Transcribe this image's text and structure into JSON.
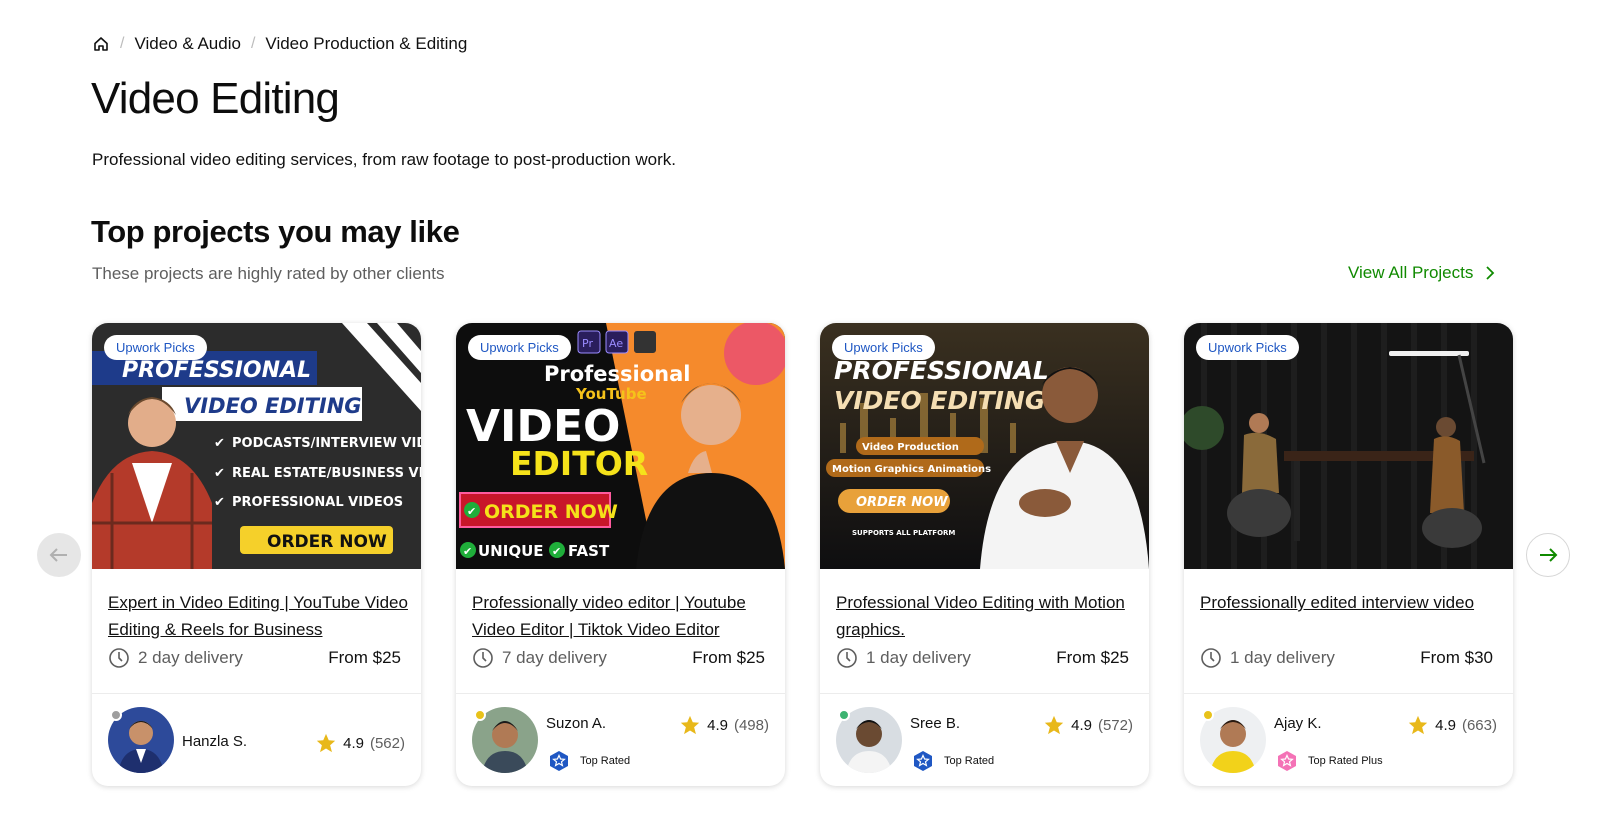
{
  "breadcrumb": {
    "home_icon": "home-icon",
    "items": [
      "Video & Audio",
      "Video Production & Editing"
    ]
  },
  "page": {
    "title": "Video Editing",
    "description": "Professional video editing services, from raw footage to post-production work."
  },
  "section": {
    "title": "Top projects you may like",
    "subtitle": "These projects are highly rated by other clients",
    "view_all": "View All Projects"
  },
  "colors": {
    "accent_green": "#108a00",
    "badge_blue": "#1f57c3",
    "top_rated_blue": "#1f57c3",
    "top_rated_plus_pink": "#f472b6",
    "star": "#e8b81a"
  },
  "cards": [
    {
      "badge": "Upwork Picks",
      "title": "Expert in Video Editing | YouTube Video Editing & Reels for Business",
      "delivery": "2 day delivery",
      "price": "From $25",
      "seller": "Hanzla S.",
      "status_color": "#9e9e9e",
      "level": "",
      "rating": "4.9",
      "reviews": "(562)",
      "thumb": {
        "line1": "PROFESSIONAL",
        "line2": "VIDEO EDITING",
        "bullets": [
          "PODCASTS/INTERVIEW VIDEO",
          "REAL ESTATE/BUSINESS VIDEO",
          "PROFESSIONAL VIDEOS"
        ],
        "cta": "ORDER NOW"
      }
    },
    {
      "badge": "Upwork Picks",
      "title": "Professionally video editor | Youtube Video Editor | Tiktok Video Editor",
      "delivery": "7 day delivery",
      "price": "From $25",
      "seller": "Suzon A.",
      "status_color": "#e8c21a",
      "level": "Top Rated",
      "level_icon": "top-rated-icon",
      "rating": "4.9",
      "reviews": "(498)",
      "thumb": {
        "apps": [
          "Pr",
          "Ae"
        ],
        "line1": "Professional",
        "line2": "YouTube",
        "line3": "VIDEO",
        "line4": "EDITOR",
        "cta": "ORDER NOW",
        "tag1": "UNIQUE",
        "tag2": "FAST"
      }
    },
    {
      "badge": "Upwork Picks",
      "title": "Professional Video Editing with Motion graphics.",
      "delivery": "1 day delivery",
      "price": "From $25",
      "seller": "Sree B.",
      "status_color": "#3cb371",
      "level": "Top Rated",
      "level_icon": "top-rated-icon",
      "rating": "4.9",
      "reviews": "(572)",
      "thumb": {
        "line1": "PROFESSIONAL",
        "line2": "VIDEO EDITING",
        "pill1": "Video Production",
        "pill2": "Motion Graphics Animations",
        "cta": "ORDER NOW",
        "footer": "SUPPORTS ALL PLATFORM"
      }
    },
    {
      "badge": "Upwork Picks",
      "title": "Professionally edited interview video",
      "delivery": "1 day delivery",
      "price": "From $30",
      "seller": "Ajay K.",
      "status_color": "#e8c21a",
      "level": "Top Rated Plus",
      "level_icon": "top-rated-plus-icon",
      "rating": "4.9",
      "reviews": "(663)",
      "thumb": {}
    }
  ]
}
